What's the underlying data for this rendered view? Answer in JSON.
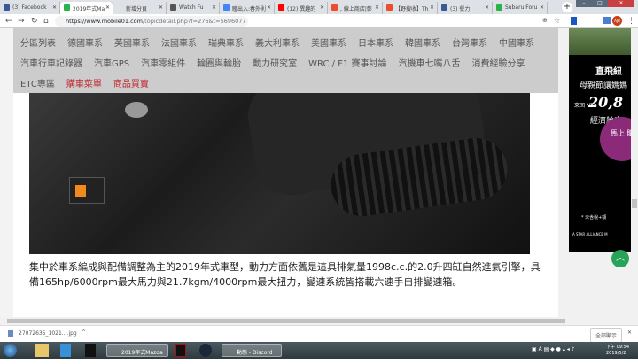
{
  "browser": {
    "tabs": [
      {
        "label": "(3) Facebook",
        "favicon_color": "#3b5998"
      },
      {
        "label": "2019年式Ma",
        "favicon_color": "#2bb24c",
        "active": true
      },
      {
        "label": "新增分頁",
        "favicon_color": ""
      },
      {
        "label": "Watch Fu",
        "favicon_color": "#555"
      },
      {
        "label": "瞳出入:春外則",
        "favicon_color": "#4285f4"
      },
      {
        "label": "(12) 異趣的",
        "favicon_color": "#ff0000"
      },
      {
        "label": ", 線上商店|彰",
        "favicon_color": "#ee4d2d"
      },
      {
        "label": "【野搜收】Th",
        "favicon_color": "#ee4d2d"
      },
      {
        "label": "(3) 餐力",
        "favicon_color": "#3b5998"
      },
      {
        "label": "Subaru Foru",
        "favicon_color": "#2bb24c"
      }
    ],
    "url_host": "https://www.mobile01.com",
    "url_path": "/topicdetail.php?f=276&t=5696077",
    "new_tab": "+",
    "profile_initials": "AJB"
  },
  "nav": {
    "row1": [
      "分區列表",
      "德國車系",
      "英國車系",
      "法國車系",
      "瑞典車系",
      "義大利車系",
      "美國車系",
      "日本車系",
      "韓國車系",
      "台灣車系",
      "中國車系"
    ],
    "row2": [
      "汽車行車記錄器",
      "汽車GPS",
      "汽車零組件",
      "輪圈與輪胎",
      "動力研究室",
      "WRC / F1 賽事討論",
      "汽機車七嘴八舌",
      "消費經驗分享"
    ],
    "row3": [
      "ETC專區"
    ],
    "row3_red": [
      "購車菜單",
      "商品買賣"
    ],
    "red_color": "#c0272d"
  },
  "article": {
    "paragraph": "集中於車系編成與配備調整為主的2019年式車型，動力方面依舊是這具排氣量1998c.c.的2.0升四缸自然進氣引擎，具備165hp/6000rpm最大馬力與21.7kgm/4000rpm最大扭力，變速系統皆搭載六速手自排變速箱。"
  },
  "ad": {
    "line1": "直飛紐",
    "line2": "母親節讓媽媽",
    "price_prefix": "來回 NT$",
    "price": "20,8",
    "line3": "經濟艙來",
    "button": "馬上 購買",
    "note": "* 未含稅+額",
    "footer": "A STAR ALLIANCE M"
  },
  "download": {
    "file": "27072635_1021....jpg",
    "show_all": "全部顯示"
  },
  "taskbar": {
    "chrome_window": "2019年式Mazda ...",
    "discord_window": "動態 - Discord",
    "time": "下午 09:54",
    "date": "2019/5/2"
  }
}
